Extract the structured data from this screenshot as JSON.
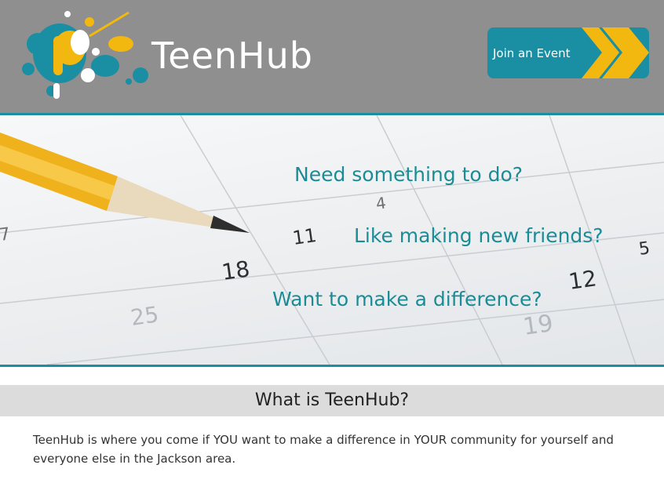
{
  "header": {
    "brand": "TeenHub",
    "cta_label": "Join an Event",
    "logo_icon": "paint-splatter-logo",
    "cta_icon": "double-chevron-right-icon"
  },
  "hero": {
    "image": "pencil-on-calendar",
    "calendar_numbers": [
      "4",
      "11",
      "18",
      "12",
      "25",
      "19",
      "7",
      "5"
    ],
    "taglines": [
      "Need something to do?",
      "Like making new friends?",
      "Want to make a difference?"
    ]
  },
  "about": {
    "title": "What is TeenHub?",
    "text": "TeenHub is where you come if YOU want to make a difference in YOUR community for yourself and everyone else in the Jackson area."
  },
  "colors": {
    "header_bg": "#8f8f8f",
    "accent_teal": "#1a8ea3",
    "accent_yellow": "#f3b80f",
    "tagline_text": "#1b8c96"
  }
}
